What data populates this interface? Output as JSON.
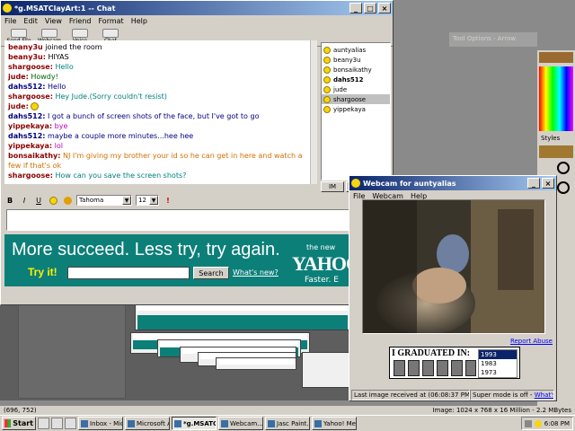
{
  "background_app": {
    "tool_options_title": "Tool Options - Arrow",
    "styles_label": "Styles",
    "status_coords": "(696, 752)",
    "status_image": "Image:  1024 x 768 x 16 Million - 2.2 MBytes"
  },
  "chat_window": {
    "title": "*g.MSATClayArt:1 -- Chat",
    "menu": [
      "File",
      "Edit",
      "View",
      "Friend",
      "Format",
      "Help"
    ],
    "toolbar": [
      "Send File",
      "Webcam",
      "Voice",
      "Chat"
    ],
    "messages": [
      {
        "nick": "beany3u",
        "text": "joined the room",
        "color": "#8b0000"
      },
      {
        "nick": "beany3u:",
        "text": "HIYAS",
        "color": "#8b0000",
        "text_color": "#000"
      },
      {
        "nick": "shargoose:",
        "text": "Hello",
        "color": "#8b0000",
        "text_color": "#008080"
      },
      {
        "nick": "jude:",
        "text": "Howdy!",
        "color": "#8b0000",
        "text_color": "#006400"
      },
      {
        "nick": "dahs512:",
        "text": "Hello",
        "color": "#000080",
        "text_color": "#000080"
      },
      {
        "nick": "shargoose:",
        "text": "Hey Jude.(Sorry couldn't resist)",
        "color": "#8b0000",
        "text_color": "#008080"
      },
      {
        "nick": "jude:",
        "text": "",
        "color": "#8b0000",
        "text_color": "#000"
      },
      {
        "nick": "dahs512:",
        "text": "I got a bunch of screen shots of the face, but I've got to go",
        "color": "#000080",
        "text_color": "#000080"
      },
      {
        "nick": "yippekaya:",
        "text": "bye",
        "color": "#8b0000",
        "text_color": "#c000c0"
      },
      {
        "nick": "dahs512:",
        "text": "maybe a couple more minutes...hee hee",
        "color": "#000080",
        "text_color": "#000080"
      },
      {
        "nick": "yippekaya:",
        "text": "lol",
        "color": "#8b0000",
        "text_color": "#c000c0"
      },
      {
        "nick": "bonsaikathy:",
        "text": "NJ I'm giving my brother your id so he can get in here and watch a few if that's ok",
        "color": "#8b0000",
        "text_color": "#d07000"
      },
      {
        "nick": "shargoose:",
        "text": "How can you save the screen shots?",
        "color": "#8b0000",
        "text_color": "#008080"
      }
    ],
    "users": [
      {
        "name": "auntyalias",
        "bold": false,
        "selected": false
      },
      {
        "name": "beany3u",
        "bold": false,
        "selected": false
      },
      {
        "name": "bonsaikathy",
        "bold": false,
        "selected": false
      },
      {
        "name": "dahs512",
        "bold": true,
        "selected": false
      },
      {
        "name": "jude",
        "bold": false,
        "selected": false
      },
      {
        "name": "shargoose",
        "bold": false,
        "selected": true
      },
      {
        "name": "yippekaya",
        "bold": false,
        "selected": false
      }
    ],
    "im_button": "IM",
    "format": {
      "bold": "B",
      "italic": "I",
      "underline": "U",
      "font": "Tahoma",
      "size": "12"
    },
    "ad": {
      "headline": "More succeed. Less try, try again.",
      "try_it": "Try it!",
      "search_button": "Search",
      "whats_new": "What's new?",
      "the_new": "the new",
      "logo": "YAHOO",
      "tagline": "Faster. E"
    }
  },
  "webcam_window": {
    "title": "Webcam for auntyalias",
    "menu": [
      "File",
      "Webcam",
      "Help"
    ],
    "report_abuse": "Report Abuse",
    "grad_title": "I GRADUATED IN:",
    "grad_years": [
      "1993",
      "1983",
      "1973"
    ],
    "status_last_image": "Last image received at (06:08:37 PM)",
    "status_super": "Super mode is off -",
    "status_whats_this": "What's this?"
  },
  "taskbar": {
    "start": "Start",
    "tasks": [
      {
        "label": "Inbox - Mic...",
        "active": false
      },
      {
        "label": "Microsoft A...",
        "active": false
      },
      {
        "label": "*g.MSATCl...",
        "active": true
      },
      {
        "label": "Webcam...",
        "active": false
      },
      {
        "label": "Jasc Paint...",
        "active": false
      },
      {
        "label": "Yahoo! Me...",
        "active": false
      }
    ],
    "clock": "6:08 PM"
  }
}
